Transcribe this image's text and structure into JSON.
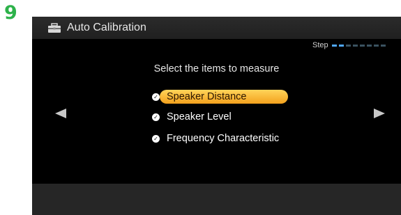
{
  "step_number": "9",
  "window": {
    "title": "Auto Calibration",
    "icon": "toolbox-icon"
  },
  "progress": {
    "label": "Step",
    "total_steps": 8,
    "current_step": 2
  },
  "prompt": "Select the items to measure",
  "items": [
    {
      "label": "Speaker Distance",
      "checked": true,
      "selected": true
    },
    {
      "label": "Speaker Level",
      "checked": true,
      "selected": false
    },
    {
      "label": "Frequency Characteristic",
      "checked": true,
      "selected": false
    }
  ],
  "navigation": {
    "left_icon": "left-arrow-icon",
    "right_icon": "right-arrow-icon"
  },
  "colors": {
    "step_number": "#2db24a",
    "highlight": "#f7b22c",
    "progress_on": "#4fa8ff"
  }
}
